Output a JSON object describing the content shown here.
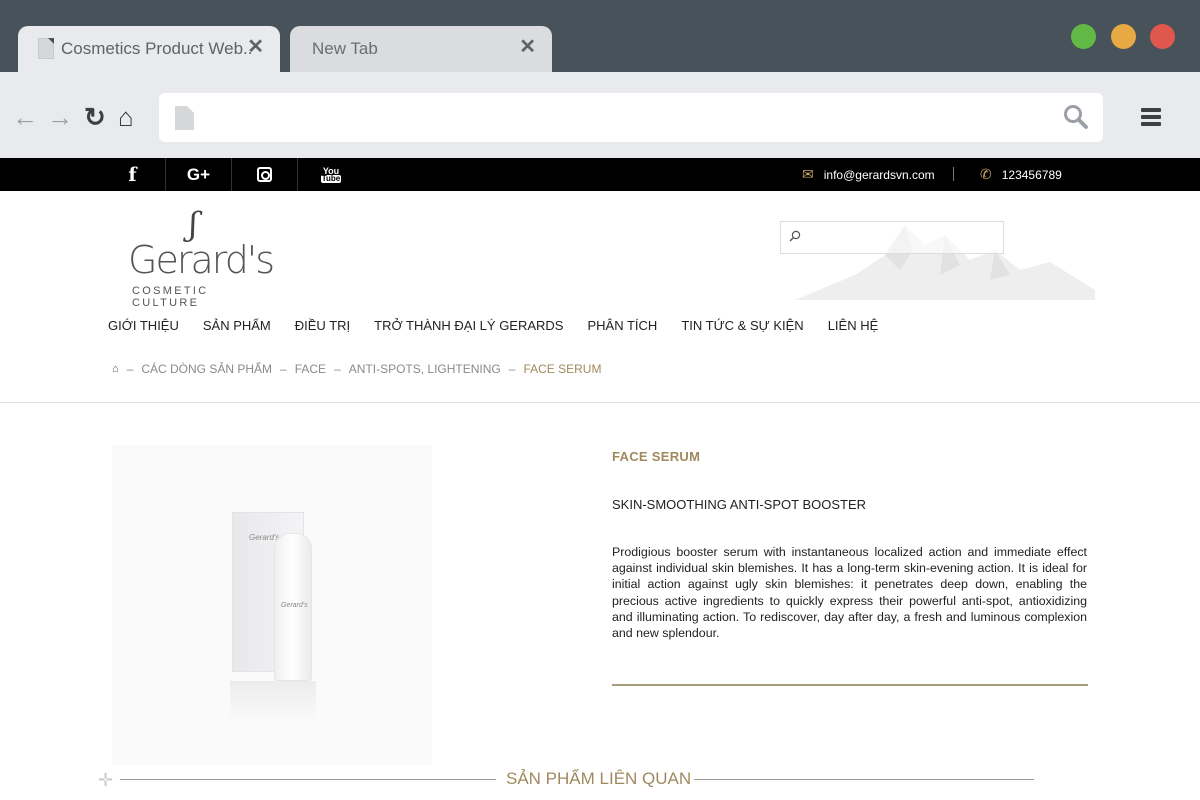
{
  "browser": {
    "tabs": [
      {
        "title": "Cosmetics Product Web..",
        "active": true
      },
      {
        "title": "New Tab",
        "active": false
      }
    ],
    "close_glyph": "✕",
    "address": "",
    "icons": {
      "back": "arrow-left-icon",
      "forward": "arrow-right-icon",
      "reload": "reload-icon",
      "home": "home-icon",
      "search": "search-icon",
      "menu": "hamburger-menu-icon"
    },
    "window_buttons": {
      "minimize": "#63b946",
      "maximize": "#e6a944",
      "close": "#e0584d"
    }
  },
  "topbar": {
    "social": [
      "facebook-icon",
      "google-plus-icon",
      "instagram-icon",
      "youtube-icon"
    ],
    "social_glyphs": {
      "facebook": "f",
      "google_plus": "G+",
      "youtube_top": "You",
      "youtube_bottom": "Tube"
    },
    "email": "info@gerardsvn.com",
    "phone": "123456789"
  },
  "logo": {
    "mark": "ʃ",
    "name": "Gerard's",
    "tagline": "COSMETIC CULTURE"
  },
  "search": {
    "placeholder": ""
  },
  "nav": [
    "GIỚI THIỆU",
    "SẢN PHẨM",
    "ĐIỀU TRỊ",
    "TRỞ THÀNH ĐẠI LÝ GERARDS",
    "PHÂN TÍCH",
    "TIN TỨC & SỰ KIỆN",
    "LIÊN HỆ"
  ],
  "breadcrumb": {
    "separator": "–",
    "items": [
      "CÁC DÒNG SẢN PHẨM",
      "FACE",
      "ANTI-SPOTS, LIGHTENING"
    ],
    "current": "FACE SERUM"
  },
  "product": {
    "box_label": "Gerard's",
    "bottle_label": "Gerard's",
    "category": "FACE SERUM",
    "subtitle": "SKIN-SMOOTHING ANTI-SPOT BOOSTER",
    "description": "Prodigious booster serum with instantaneous localized action and immediate effect against individual skin blemishes. It has a long-term skin-evening action. It is ideal for initial action against ugly skin blemishes: it penetrates deep down, enabling the precious active ingredients to quickly express their powerful anti-spot, antioxidizing and illuminating action. To rediscover, day after day, a fresh and luminous complexion and new splendour."
  },
  "related": {
    "plus_glyph": "✛",
    "title": "SẢN PHẨM LIÊN QUAN"
  },
  "colors": {
    "accent": "#a0895f",
    "topbar": "#000000",
    "chrome": "#47525a"
  }
}
